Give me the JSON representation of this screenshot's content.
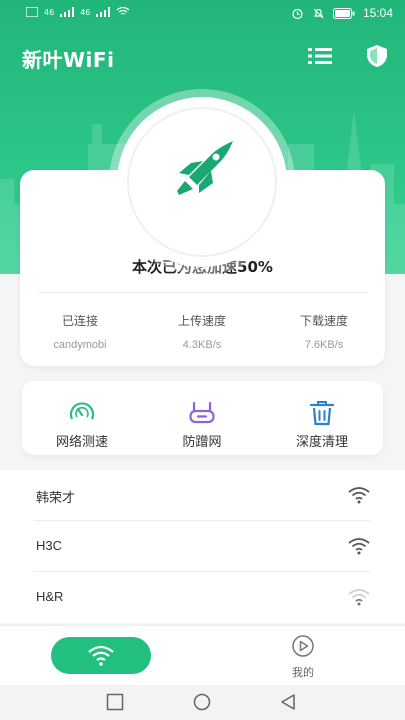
{
  "status_bar": {
    "time": "15:04",
    "left_signals": [
      "46",
      "46"
    ]
  },
  "header": {
    "title": "新叶WiFi"
  },
  "speed_card": {
    "boost_message": "本次已为您加速50%",
    "stats": [
      {
        "label": "已连接",
        "value": "candymobi"
      },
      {
        "label": "上传速度",
        "value": "4.3KB/s"
      },
      {
        "label": "下载速度",
        "value": "7.6KB/s"
      }
    ]
  },
  "tools": [
    {
      "label": "网络测速",
      "icon": "speedometer-icon",
      "color": "#2fb98a"
    },
    {
      "label": "防蹭网",
      "icon": "router-icon",
      "color": "#8a64d8"
    },
    {
      "label": "深度清理",
      "icon": "trash-icon",
      "color": "#2f7fd1"
    }
  ],
  "wifi_networks": [
    {
      "name": "韩荣才",
      "signal": "strong"
    },
    {
      "name": "H3C",
      "signal": "strong"
    },
    {
      "name": "H&R",
      "signal": "weak"
    }
  ],
  "bottom_nav": {
    "mine_label": "我的"
  },
  "colors": {
    "brand": "#22c07e",
    "hero": "#2cc688"
  }
}
